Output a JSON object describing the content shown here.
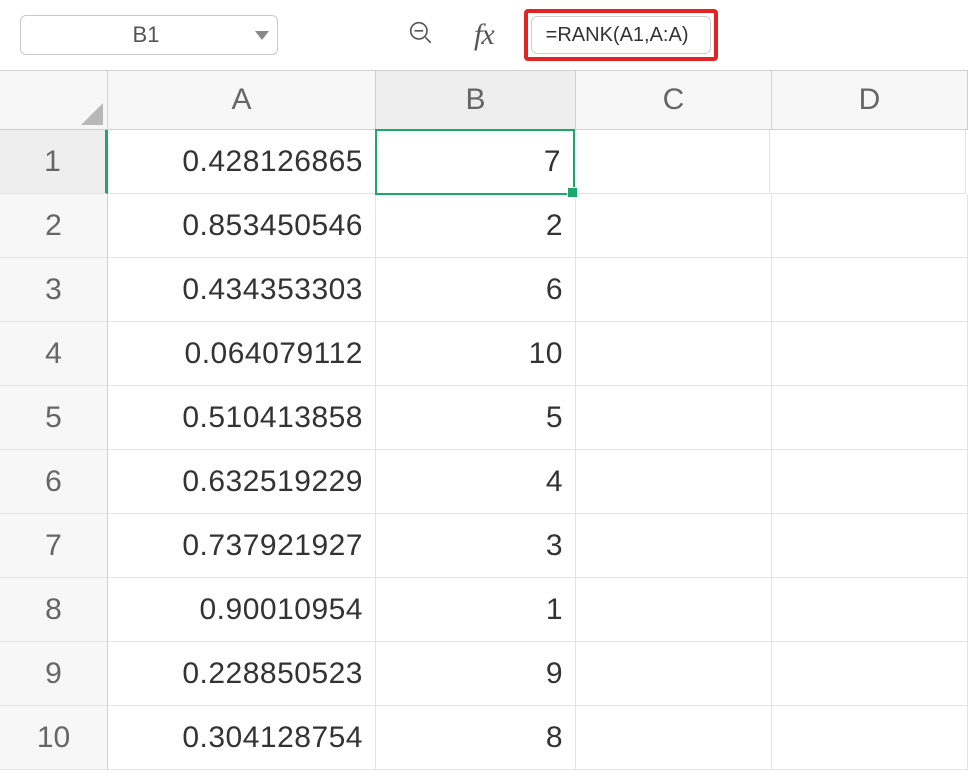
{
  "toolbar": {
    "name_box": "B1",
    "formula": "=RANK(A1,A:A)"
  },
  "columns": [
    "A",
    "B",
    "C",
    "D"
  ],
  "rows": [
    {
      "n": "1",
      "A": "0.428126865",
      "B": "7",
      "C": "",
      "D": ""
    },
    {
      "n": "2",
      "A": "0.853450546",
      "B": "2",
      "C": "",
      "D": ""
    },
    {
      "n": "3",
      "A": "0.434353303",
      "B": "6",
      "C": "",
      "D": ""
    },
    {
      "n": "4",
      "A": "0.064079112",
      "B": "10",
      "C": "",
      "D": ""
    },
    {
      "n": "5",
      "A": "0.510413858",
      "B": "5",
      "C": "",
      "D": ""
    },
    {
      "n": "6",
      "A": "0.632519229",
      "B": "4",
      "C": "",
      "D": ""
    },
    {
      "n": "7",
      "A": "0.737921927",
      "B": "3",
      "C": "",
      "D": ""
    },
    {
      "n": "8",
      "A": "0.90010954",
      "B": "1",
      "C": "",
      "D": ""
    },
    {
      "n": "9",
      "A": "0.228850523",
      "B": "9",
      "C": "",
      "D": ""
    },
    {
      "n": "10",
      "A": "0.304128754",
      "B": "8",
      "C": "",
      "D": ""
    }
  ],
  "active_cell": "B1",
  "chart_data": {
    "type": "table",
    "columns": [
      "A",
      "B"
    ],
    "rows": [
      [
        0.428126865,
        7
      ],
      [
        0.853450546,
        2
      ],
      [
        0.434353303,
        6
      ],
      [
        0.064079112,
        10
      ],
      [
        0.510413858,
        5
      ],
      [
        0.632519229,
        4
      ],
      [
        0.737921927,
        3
      ],
      [
        0.90010954,
        1
      ],
      [
        0.228850523,
        9
      ],
      [
        0.304128754,
        8
      ]
    ]
  }
}
